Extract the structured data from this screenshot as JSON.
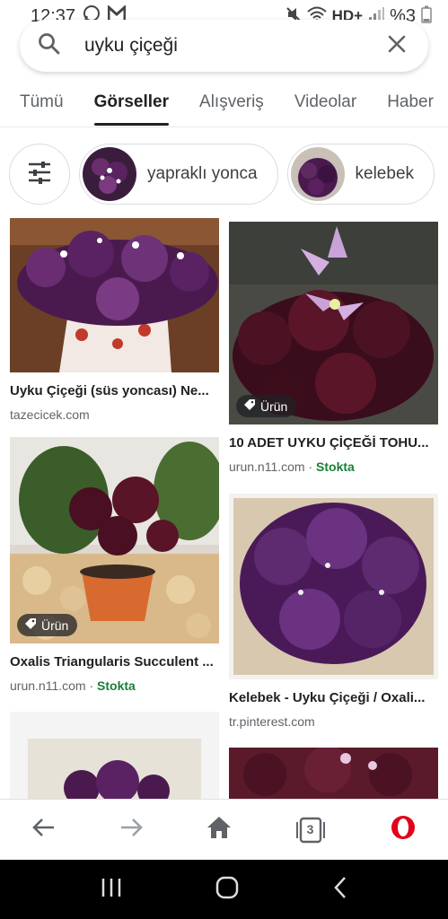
{
  "status": {
    "time": "12:37",
    "network": "HD+",
    "battery": "%3"
  },
  "search": {
    "query": "uyku çiçeği"
  },
  "tabs": [
    "Tümü",
    "Görseller",
    "Alışveriş",
    "Videolar",
    "Haber"
  ],
  "chips": [
    {
      "label": "yapraklı yonca"
    },
    {
      "label": "kelebek"
    }
  ],
  "results": [
    {
      "caption": "Uyku Çiçeği (süs yoncası) Ne...",
      "source": "tazecicek.com"
    },
    {
      "caption": "10 ADET UYKU ÇİÇEĞİ TOHU...",
      "source": "urun.n11.com",
      "stock": "Stokta",
      "badge": "Ürün"
    },
    {
      "caption": "Oxalis Triangularis Succulent ...",
      "source": "urun.n11.com",
      "stock": "Stokta",
      "badge": "Ürün"
    },
    {
      "caption": "Kelebek - Uyku Çiçeği / Oxali...",
      "source": "tr.pinterest.com"
    }
  ],
  "bottom_nav": {
    "tab_count": "3"
  },
  "colors": {
    "purple": "#4a1a4e",
    "stock_green": "#188038",
    "opera_red": "#e3001b"
  }
}
